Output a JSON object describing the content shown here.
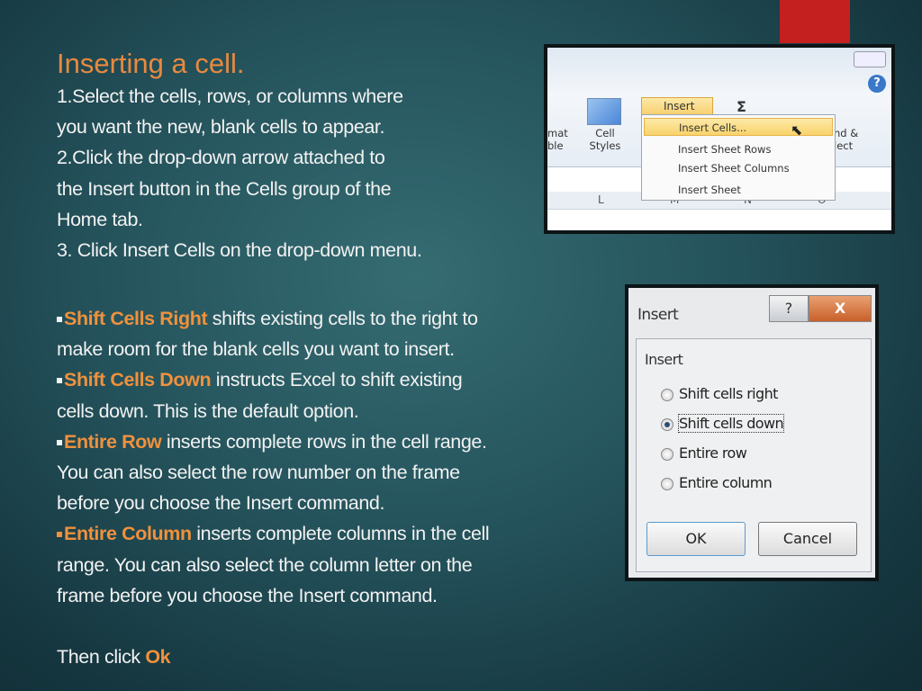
{
  "title": "Inserting a cell.",
  "steps": [
    "1.Select the cells, rows, or columns where",
    "you want the new, blank cells to appear.",
    "2.Click the drop-down arrow attached to",
    "the Insert button in the Cells group of the",
    "Home tab.",
    "3. Click Insert Cells on the drop-down menu."
  ],
  "options": [
    {
      "term": "Shift Cells Right",
      "l1": " shifts existing cells to the right to",
      "l2": "make room for the blank cells you want to insert."
    },
    {
      "term": "Shift Cells Down",
      "l1": " instructs Excel to shift existing",
      "l2": "cells down. This is the default option."
    },
    {
      "term": "Entire Row",
      "l1": " inserts complete rows in the cell range.",
      "l2": "You can also select the row number on the frame",
      "l3": "before you choose the Insert command."
    },
    {
      "term": "Entire Column",
      "l1": " inserts complete columns in the cell",
      "l2": "range. You can also select the column letter on the",
      "l3": "frame before you choose the Insert command."
    }
  ],
  "closing": {
    "text": "Then click ",
    "ok": "Ok"
  },
  "ribbon": {
    "insert": "Insert",
    "sigma": "Σ",
    "format_table": "mat\nble",
    "cell_styles": "Cell Styles",
    "find": "nd &\nlect",
    "menu": [
      "Insert Cells...",
      "Insert Sheet Rows",
      "Insert Sheet Columns",
      "Insert Sheet"
    ],
    "columns": [
      "L",
      "M",
      "N",
      "O"
    ]
  },
  "dialog": {
    "title": "Insert",
    "group": "Insert",
    "help": "?",
    "close": "X",
    "options": [
      "Shift cells right",
      "Shift cells down",
      "Entire row",
      "Entire column"
    ],
    "selected": "Shift cells down",
    "ok": "OK",
    "cancel": "Cancel"
  },
  "colors": {
    "accent": "#f0913c",
    "title": "#e8893f",
    "background": "#24525b",
    "red_bar": "#c4201f"
  }
}
